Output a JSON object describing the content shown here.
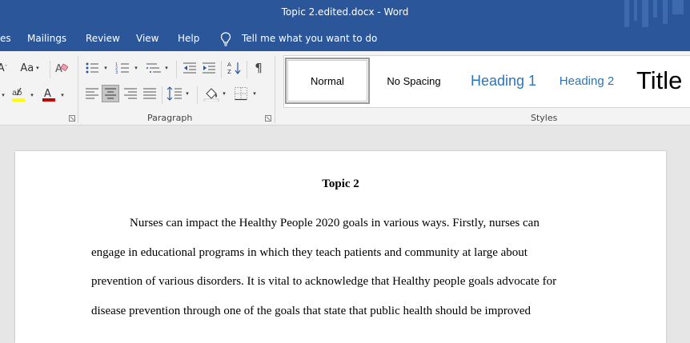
{
  "window": {
    "title": "Topic 2.edited.docx  -  Word"
  },
  "menu": {
    "items": [
      "es",
      "Mailings",
      "Review",
      "View",
      "Help"
    ],
    "tell_me": "Tell me what you want to do"
  },
  "ribbon": {
    "font_group": {
      "fragment_letter": "A",
      "change_case": "Aa"
    },
    "paragraph_label": "Paragraph",
    "styles_label": "Styles",
    "styles": [
      "Normal",
      "No Spacing",
      "Heading 1",
      "Heading 2",
      "Title"
    ]
  },
  "document": {
    "title": "Topic 2",
    "lines": [
      "Nurses can impact the Healthy People 2020 goals in various ways. Firstly, nurses can",
      "engage in educational programs in which they teach patients and community at large about",
      "prevention of various disorders. It is vital to acknowledge that Healthy people goals advocate for",
      "disease prevention through one of the goals that state that public health should be improved"
    ]
  },
  "colors": {
    "word_blue": "#2b579a",
    "ribbon_bg": "#f3f3f3",
    "heading_blue": "#2e74b5",
    "font_color_red": "#c00000",
    "highlight_yellow": "#ffff00"
  }
}
